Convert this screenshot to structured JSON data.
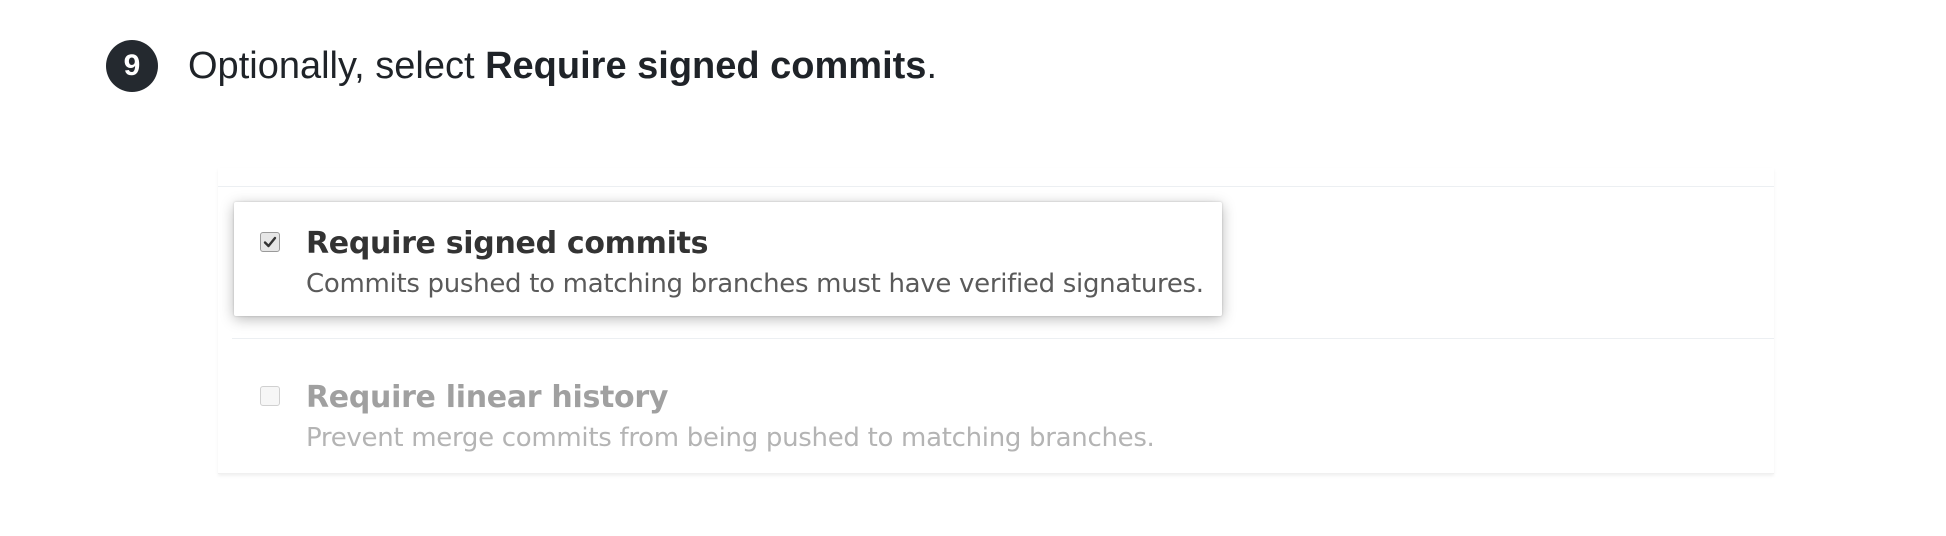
{
  "step": {
    "number": "9",
    "prefix": "Optionally, select ",
    "bold": "Require signed commits",
    "suffix": "."
  },
  "options": [
    {
      "title": "Require signed commits",
      "description": "Commits pushed to matching branches must have verified signatures.",
      "checked": true,
      "highlighted": true
    },
    {
      "title": "Require linear history",
      "description": "Prevent merge commits from being pushed to matching branches.",
      "checked": false,
      "disabled": true
    }
  ],
  "colors": {
    "badge": "#24292f",
    "text": "#1f2328",
    "muted": "#a0a0a0"
  },
  "icons": {
    "checkmark": "check-icon"
  }
}
